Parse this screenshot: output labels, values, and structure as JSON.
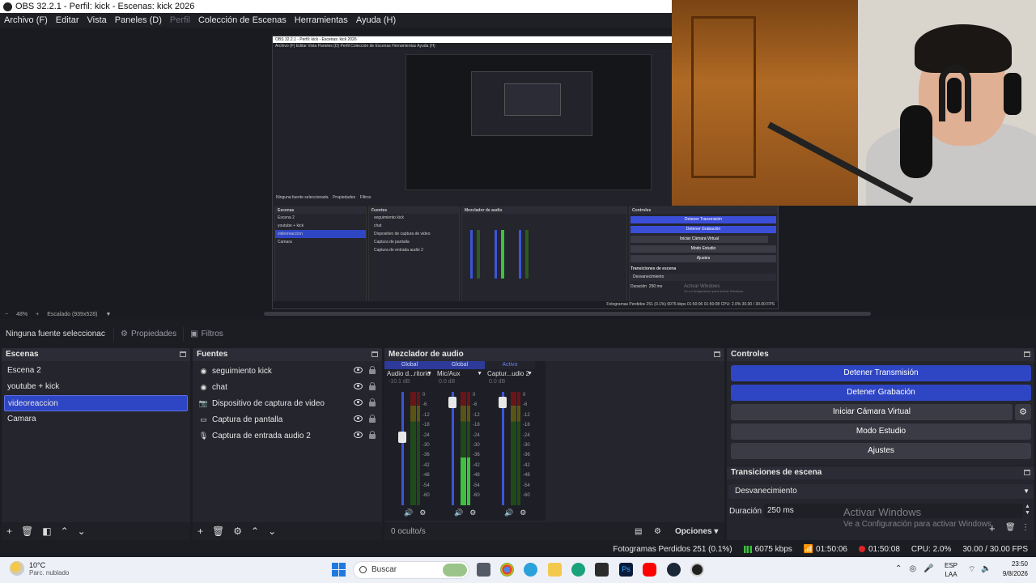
{
  "window": {
    "title": "OBS 32.2.1 - Perfil: kick - Escenas: kick 2026"
  },
  "menu": {
    "items": [
      "Archivo (F)",
      "Editar",
      "Vista",
      "Paneles (D)",
      "Perfil",
      "Colección de Escenas",
      "Herramientas",
      "Ayuda (H)"
    ]
  },
  "preview": {
    "zoom": "48%",
    "scale_label": "Escalado (939x528)"
  },
  "source_bar": {
    "no_selection": "Ninguna fuente seleccionac",
    "properties": "Propiedades",
    "filters": "Filtros"
  },
  "scenes": {
    "title": "Escenas",
    "items": [
      "Escena 2",
      "youtube + kick",
      "videoreaccion",
      "Camara"
    ],
    "selected_index": 2
  },
  "sources": {
    "title": "Fuentes",
    "items": [
      {
        "label": "seguimiento kick",
        "icon": "browser-icon"
      },
      {
        "label": "chat",
        "icon": "browser-icon"
      },
      {
        "label": "Dispositivo de captura de video",
        "icon": "camera-icon"
      },
      {
        "label": "Captura de pantalla",
        "icon": "monitor-icon"
      },
      {
        "label": "Captura de entrada audio 2",
        "icon": "microphone-icon"
      }
    ]
  },
  "mixer": {
    "title": "Mezclador de audio",
    "channels": [
      {
        "tag": "Global",
        "name": "Audio d...ritorio",
        "db": "-10.1 dB",
        "fader_level": 0.65,
        "meter_level": 0
      },
      {
        "tag": "Global",
        "name": "Mic/Aux",
        "db": "0.0 dB",
        "fader_level": 0.96,
        "meter_level": 0.42
      },
      {
        "tag": "Activo",
        "name": "Captur...udio 2",
        "db": "0.0 dB",
        "fader_level": 0.96,
        "meter_level": 0
      }
    ],
    "scale": [
      "0",
      "-6",
      "-12",
      "-18",
      "-24",
      "-30",
      "-36",
      "-42",
      "-48",
      "-54",
      "-60"
    ],
    "hidden_label": "0 oculto/s",
    "options_label": "Opciones"
  },
  "controls": {
    "title": "Controles",
    "stop_stream": "Detener Transmisión",
    "stop_record": "Detener Grabación",
    "virtual_cam": "Iniciar Cámara Virtual",
    "studio_mode": "Modo Estudio",
    "settings": "Ajustes"
  },
  "transitions": {
    "title": "Transiciones de escena",
    "selected": "Desvanecimiento",
    "duration_label": "Duración",
    "duration_value": "250 ms"
  },
  "watermark": {
    "line1": "Activar Windows",
    "line2": "Ve a Configuración para activar Windows."
  },
  "status": {
    "dropped": "Fotogramas Perdidos 251 (0.1%)",
    "bitrate": "6075 kbps",
    "stream_time": "01:50:06",
    "record_time": "01:50:08",
    "cpu": "CPU: 2.0%",
    "fps": "30.00 / 30.00 FPS"
  },
  "taskbar": {
    "temp": "10°C",
    "weather": "Parc. nublado",
    "search_placeholder": "Buscar",
    "lang1": "ESP",
    "lang2": "LAA",
    "time": "23:50",
    "date": "9/8/2026"
  },
  "nested_preview": {
    "title": "OBS 32.2.1 - Perfil: kick - Escenas: kick 2026",
    "menu": "Archivo (F)   Editar   Vista   Paneles (D)   Perfil   Colección de Escenas   Herramientas   Ayuda (H)",
    "no_selection": "Ninguna fuente seleccionada",
    "properties": "Propiedades",
    "filters": "Filtros",
    "scene_items": [
      "Escena 2",
      "youtube + kick",
      "videoreaccion",
      "Camara"
    ],
    "source_items": [
      "seguimiento kick",
      "chat",
      "Dispositivo de captura de video",
      "Captura de pantalla",
      "Captura de entrada audio 2"
    ],
    "scenes_title": "Escenas",
    "sources_title": "Fuentes",
    "mixer_title": "Mezclador de audio",
    "controls_title": "Controles",
    "buttons": [
      "Detener Transmisión",
      "Detener Grabación",
      "Iniciar Cámara Virtual",
      "Modo Estudio",
      "Ajustes"
    ],
    "transitions_title": "Transiciones de escena",
    "transition": "Desvanecimiento",
    "duration": "Duración",
    "duration_value": "250 ms",
    "status": "Fotogramas Perdidos 251 (0.1%)   6075 kbps   01:50:06   01:50:08   CPU: 2.0%   30.00 / 30.00 FPS",
    "watermark1": "Activar Windows",
    "watermark2": "Ve a Configuración para activar Windows."
  },
  "colors": {
    "accent": "#2f46c4",
    "panel": "#24252d",
    "background": "#1c1d23"
  }
}
